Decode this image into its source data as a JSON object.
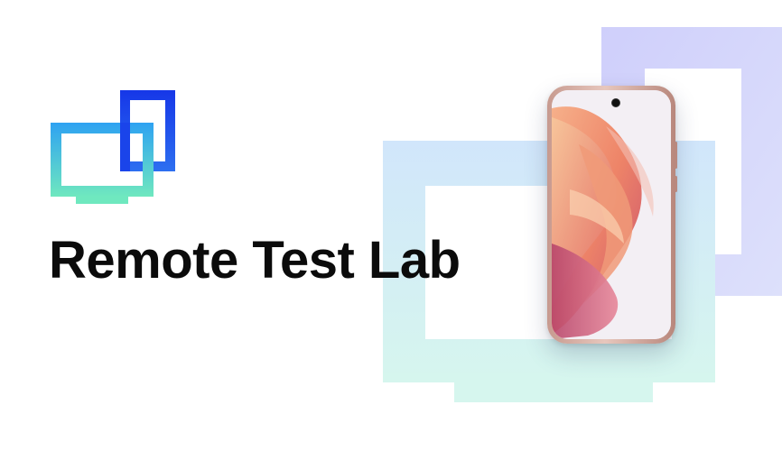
{
  "banner": {
    "title": "Remote Test Lab",
    "logo_icon": "overlapping-screens-icon",
    "decoration": "overlapping-frames-graphic",
    "device": "smartphone-illustration",
    "colors": {
      "logo_blue": "#1a36e6",
      "logo_cyan": "#2fa9f0",
      "logo_mint": "#6fe6c0",
      "frame_mint": "#d8f6ef",
      "frame_sky": "#d4e9fb",
      "frame_lavender": "#cfd0fb",
      "title": "#0b0b0b",
      "wallpaper": "#ef8a6a"
    }
  }
}
